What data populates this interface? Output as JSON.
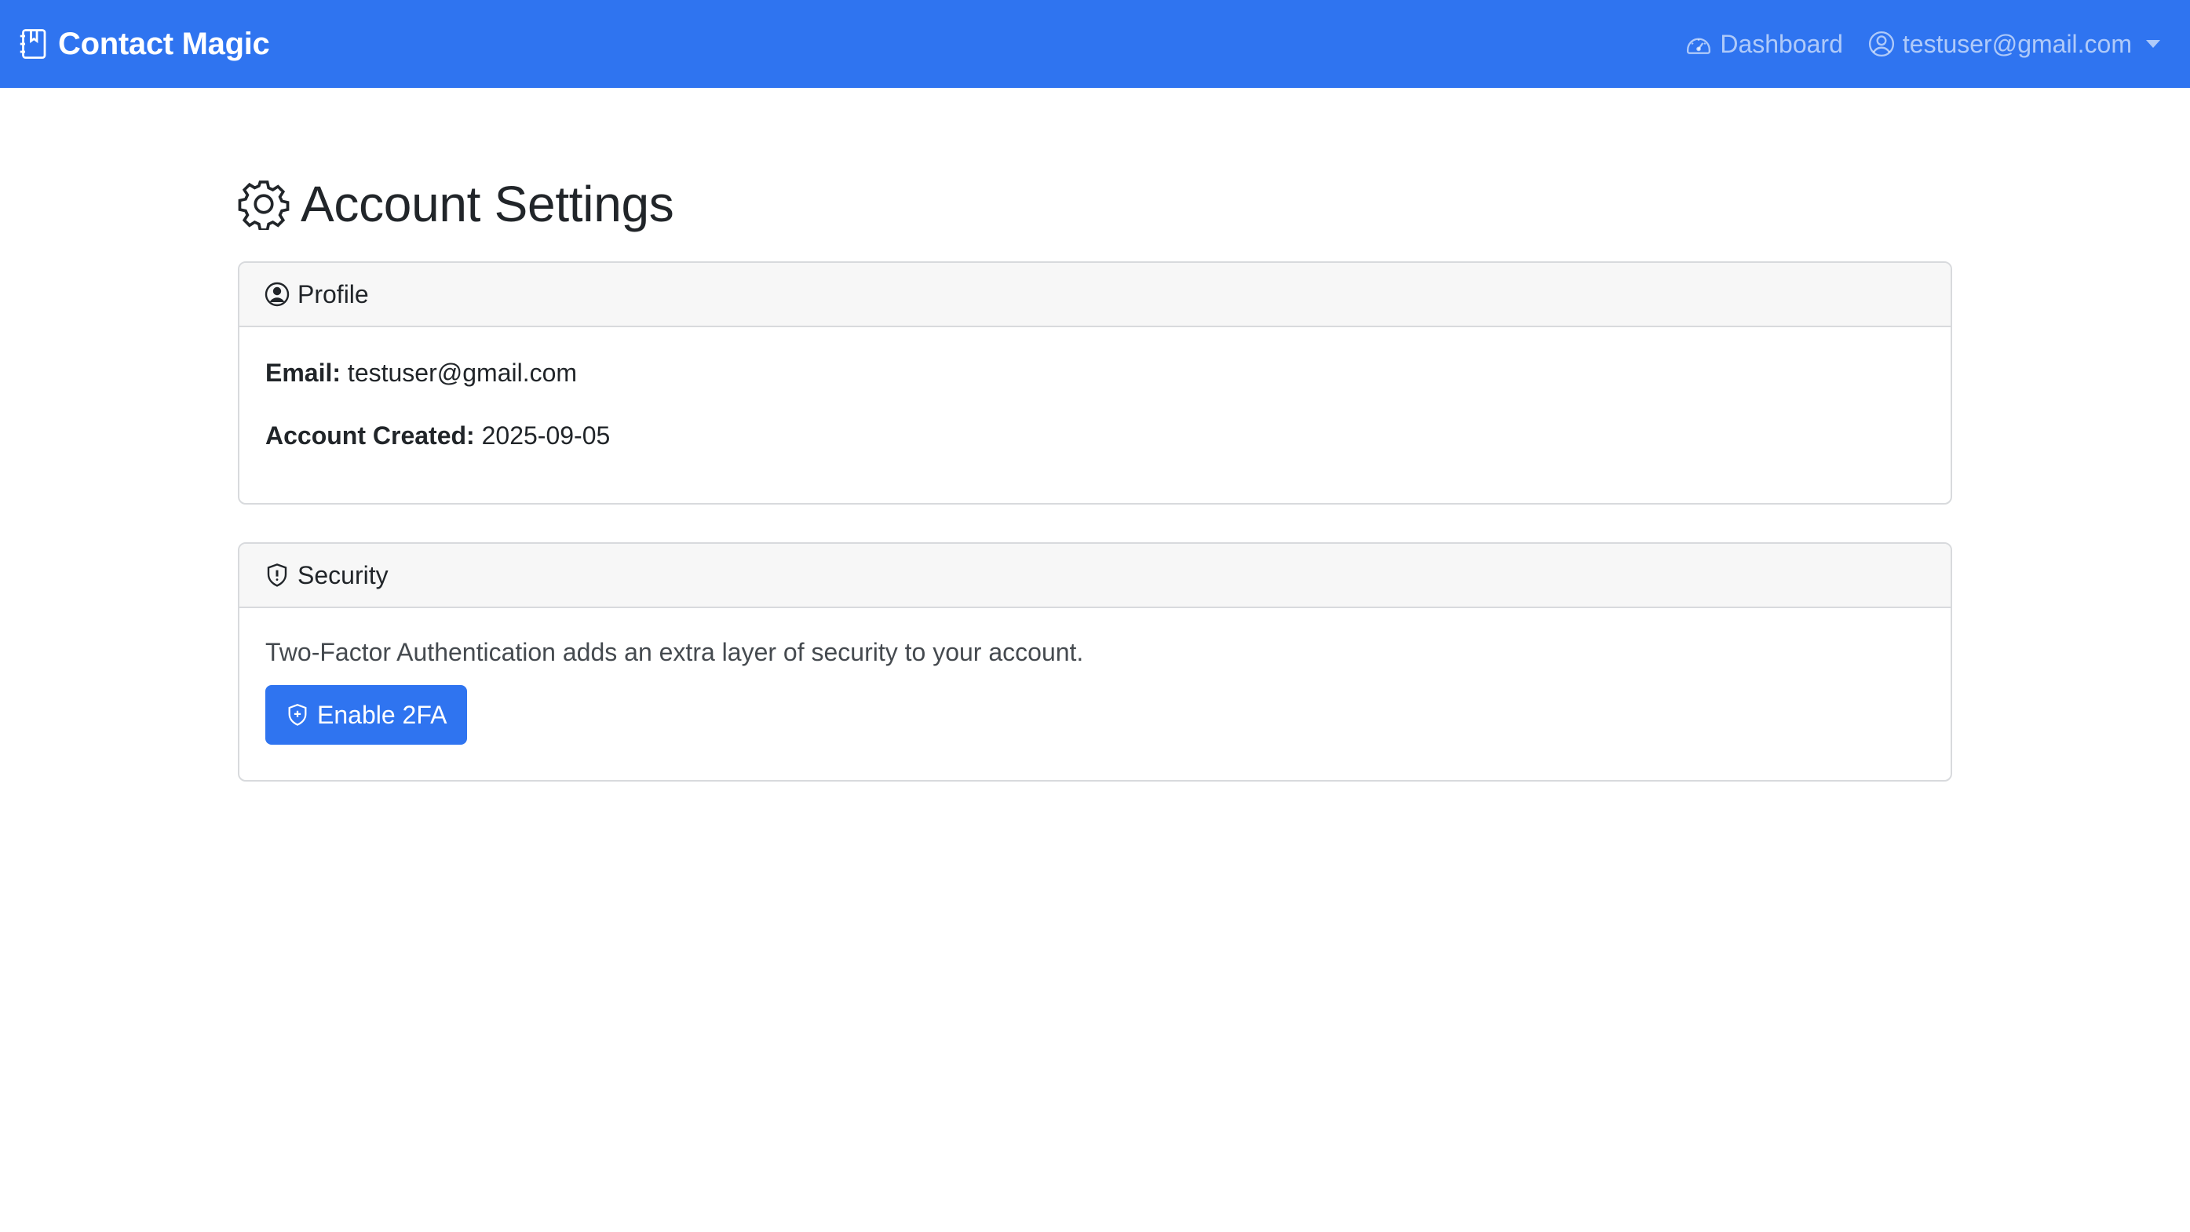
{
  "navbar": {
    "brand": "Contact Magic",
    "dashboard_label": "Dashboard",
    "user_email": "testuser@gmail.com"
  },
  "page": {
    "title": "Account Settings"
  },
  "profile": {
    "header": "Profile",
    "email_label": "Email:",
    "email_value": "testuser@gmail.com",
    "created_label": "Account Created:",
    "created_value": "2025-09-05"
  },
  "security": {
    "header": "Security",
    "description": "Two-Factor Authentication adds an extra layer of security to your account.",
    "enable_button": "Enable 2FA"
  },
  "colors": {
    "primary": "#2f74f0",
    "card_header_bg": "#f7f7f7",
    "border": "#d8dadd"
  },
  "icons": {
    "brand": "journal-bookmark-icon",
    "dashboard": "speedometer-icon",
    "user": "person-circle-icon",
    "page_title": "gear-icon",
    "profile": "person-circle-icon",
    "security": "shield-exclamation-icon",
    "enable_button": "shield-plus-icon"
  }
}
